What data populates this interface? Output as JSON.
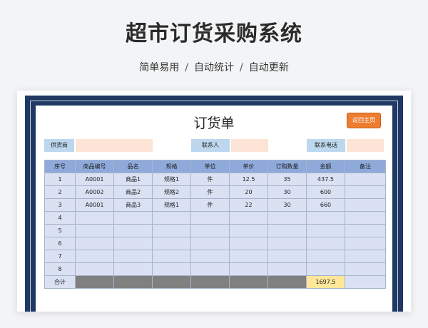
{
  "page": {
    "title": "超市订货采购系统",
    "subtitle": [
      "简单易用",
      "自动统计",
      "自动更新"
    ],
    "separator": "/"
  },
  "sheet": {
    "title": "订货单",
    "home_button": "返回主页",
    "supplier_label": "供货商",
    "supplier_value": "",
    "contact_label": "联系人",
    "contact_value": "",
    "phone_label": "联系电话",
    "phone_value": ""
  },
  "table": {
    "headers": [
      "序号",
      "商品编号",
      "品名",
      "规格",
      "单位",
      "单价",
      "订购数量",
      "金额",
      "备注"
    ],
    "rows": [
      [
        "1",
        "A0001",
        "商品1",
        "规格1",
        "件",
        "12.5",
        "35",
        "437.5",
        ""
      ],
      [
        "2",
        "A0002",
        "商品2",
        "规格2",
        "件",
        "20",
        "30",
        "600",
        ""
      ],
      [
        "3",
        "A0001",
        "商品3",
        "规格1",
        "件",
        "22",
        "30",
        "660",
        ""
      ],
      [
        "4",
        "",
        "",
        "",
        "",
        "",
        "",
        "",
        ""
      ],
      [
        "5",
        "",
        "",
        "",
        "",
        "",
        "",
        "",
        ""
      ],
      [
        "6",
        "",
        "",
        "",
        "",
        "",
        "",
        "",
        ""
      ],
      [
        "7",
        "",
        "",
        "",
        "",
        "",
        "",
        "",
        ""
      ],
      [
        "8",
        "",
        "",
        "",
        "",
        "",
        "",
        "",
        ""
      ]
    ],
    "total_label": "合计",
    "total_value": "1697.5"
  },
  "colors": {
    "frame": "#1f3864",
    "header_fill": "#8eaadb",
    "cell_fill": "#d9e1f2",
    "label_fill": "#bdd7ee",
    "input_fill": "#fce4d6",
    "button": "#ed7d31",
    "total_fill": "#ffe699",
    "merged_fill": "#808080"
  }
}
